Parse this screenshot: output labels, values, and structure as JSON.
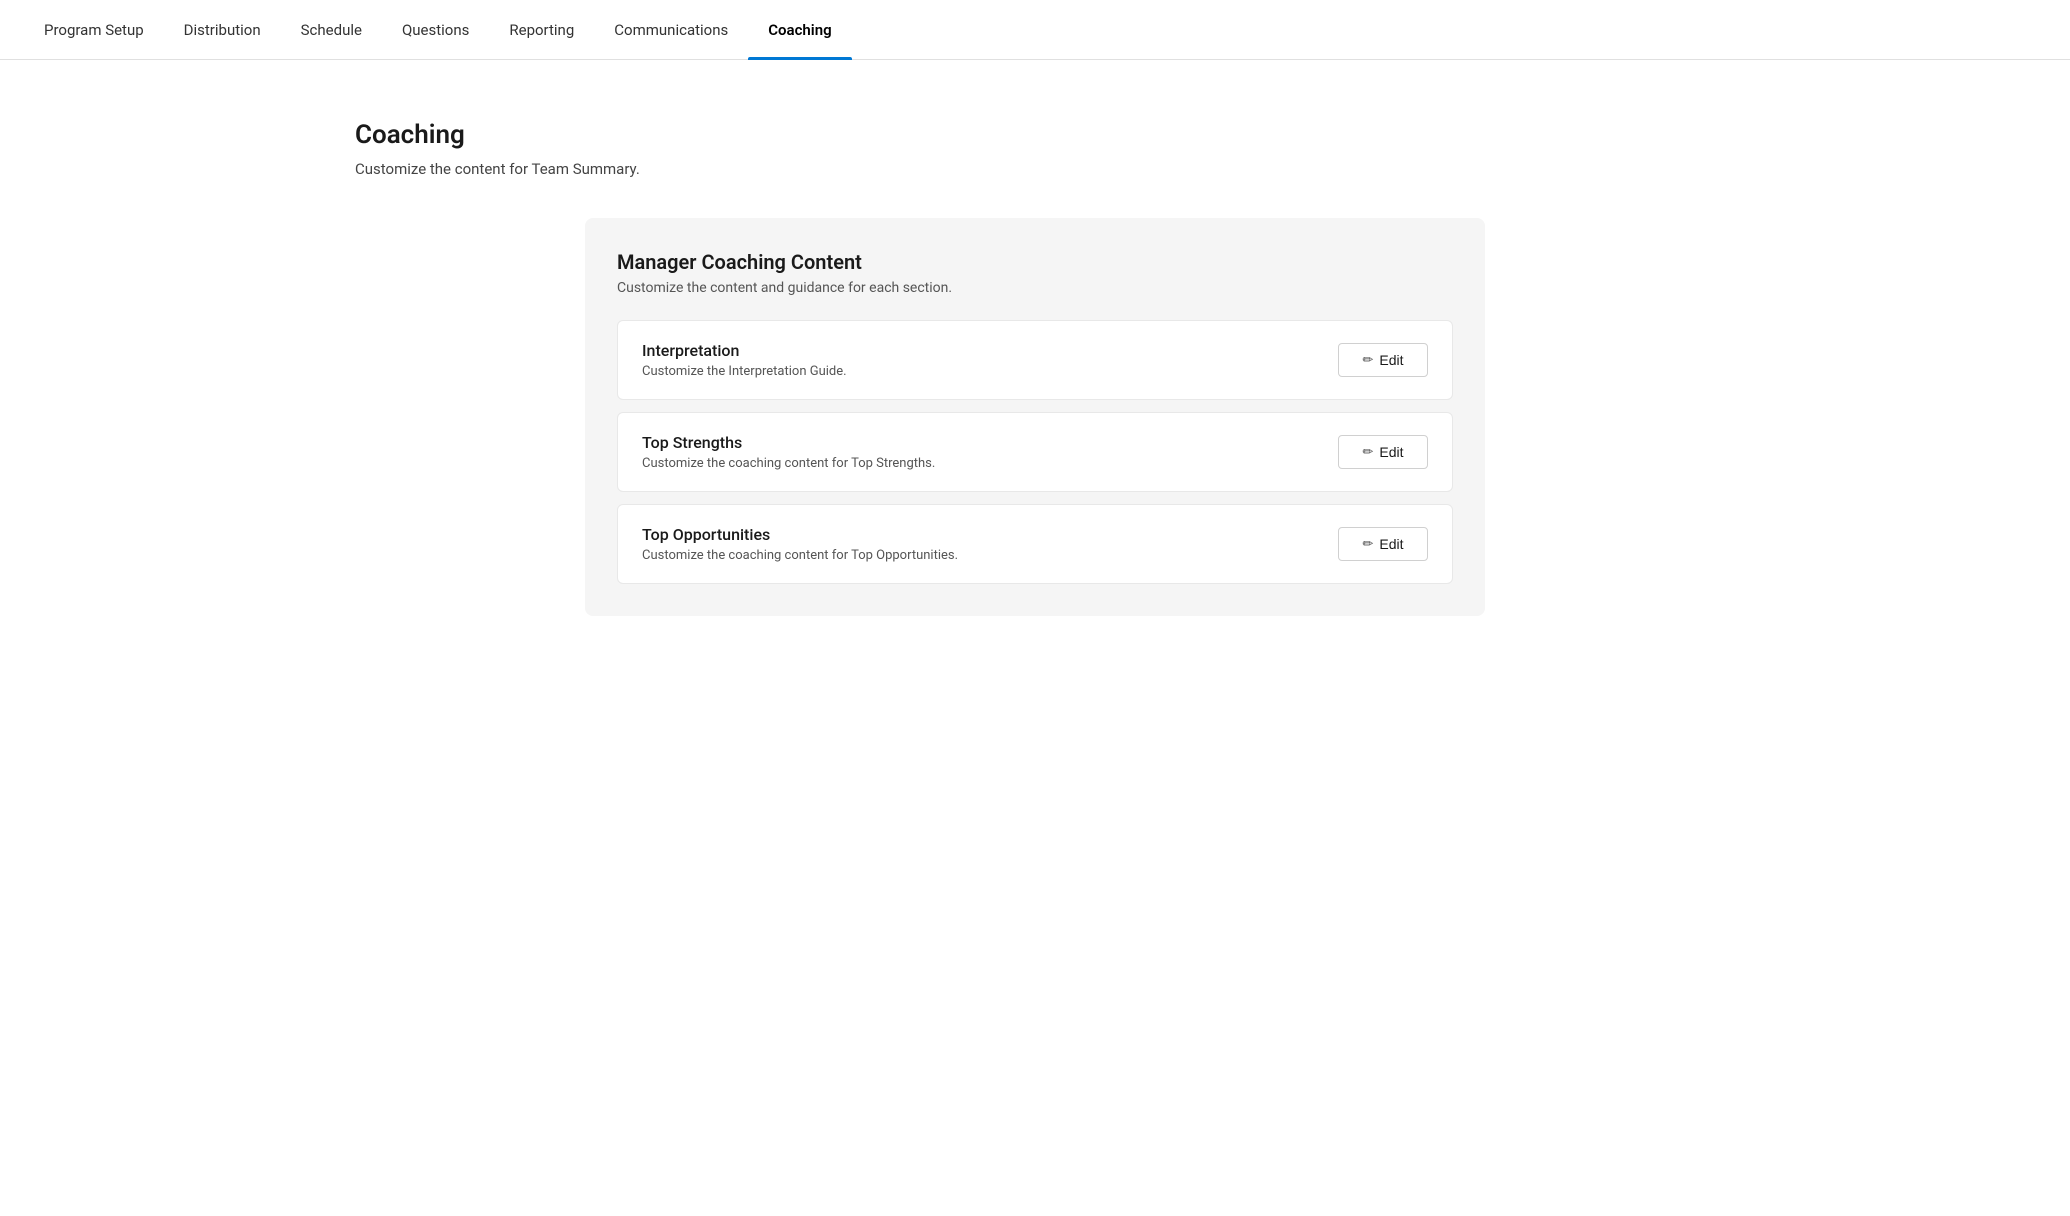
{
  "nav": {
    "items": [
      {
        "id": "program-setup",
        "label": "Program Setup",
        "active": false
      },
      {
        "id": "distribution",
        "label": "Distribution",
        "active": false
      },
      {
        "id": "schedule",
        "label": "Schedule",
        "active": false
      },
      {
        "id": "questions",
        "label": "Questions",
        "active": false
      },
      {
        "id": "reporting",
        "label": "Reporting",
        "active": false
      },
      {
        "id": "communications",
        "label": "Communications",
        "active": false
      },
      {
        "id": "coaching",
        "label": "Coaching",
        "active": true
      }
    ]
  },
  "page": {
    "title": "Coaching",
    "subtitle": "Customize the content for Team Summary."
  },
  "card": {
    "title": "Manager Coaching Content",
    "subtitle": "Customize the content and guidance for each section.",
    "sections": [
      {
        "id": "interpretation",
        "title": "Interpretation",
        "description": "Customize the Interpretation Guide.",
        "button_label": "Edit"
      },
      {
        "id": "top-strengths",
        "title": "Top Strengths",
        "description": "Customize the coaching content for Top Strengths.",
        "button_label": "Edit"
      },
      {
        "id": "top-opportunities",
        "title": "Top Opportunities",
        "description": "Customize the coaching content for Top Opportunities.",
        "button_label": "Edit"
      }
    ]
  },
  "icons": {
    "edit": "✏"
  }
}
